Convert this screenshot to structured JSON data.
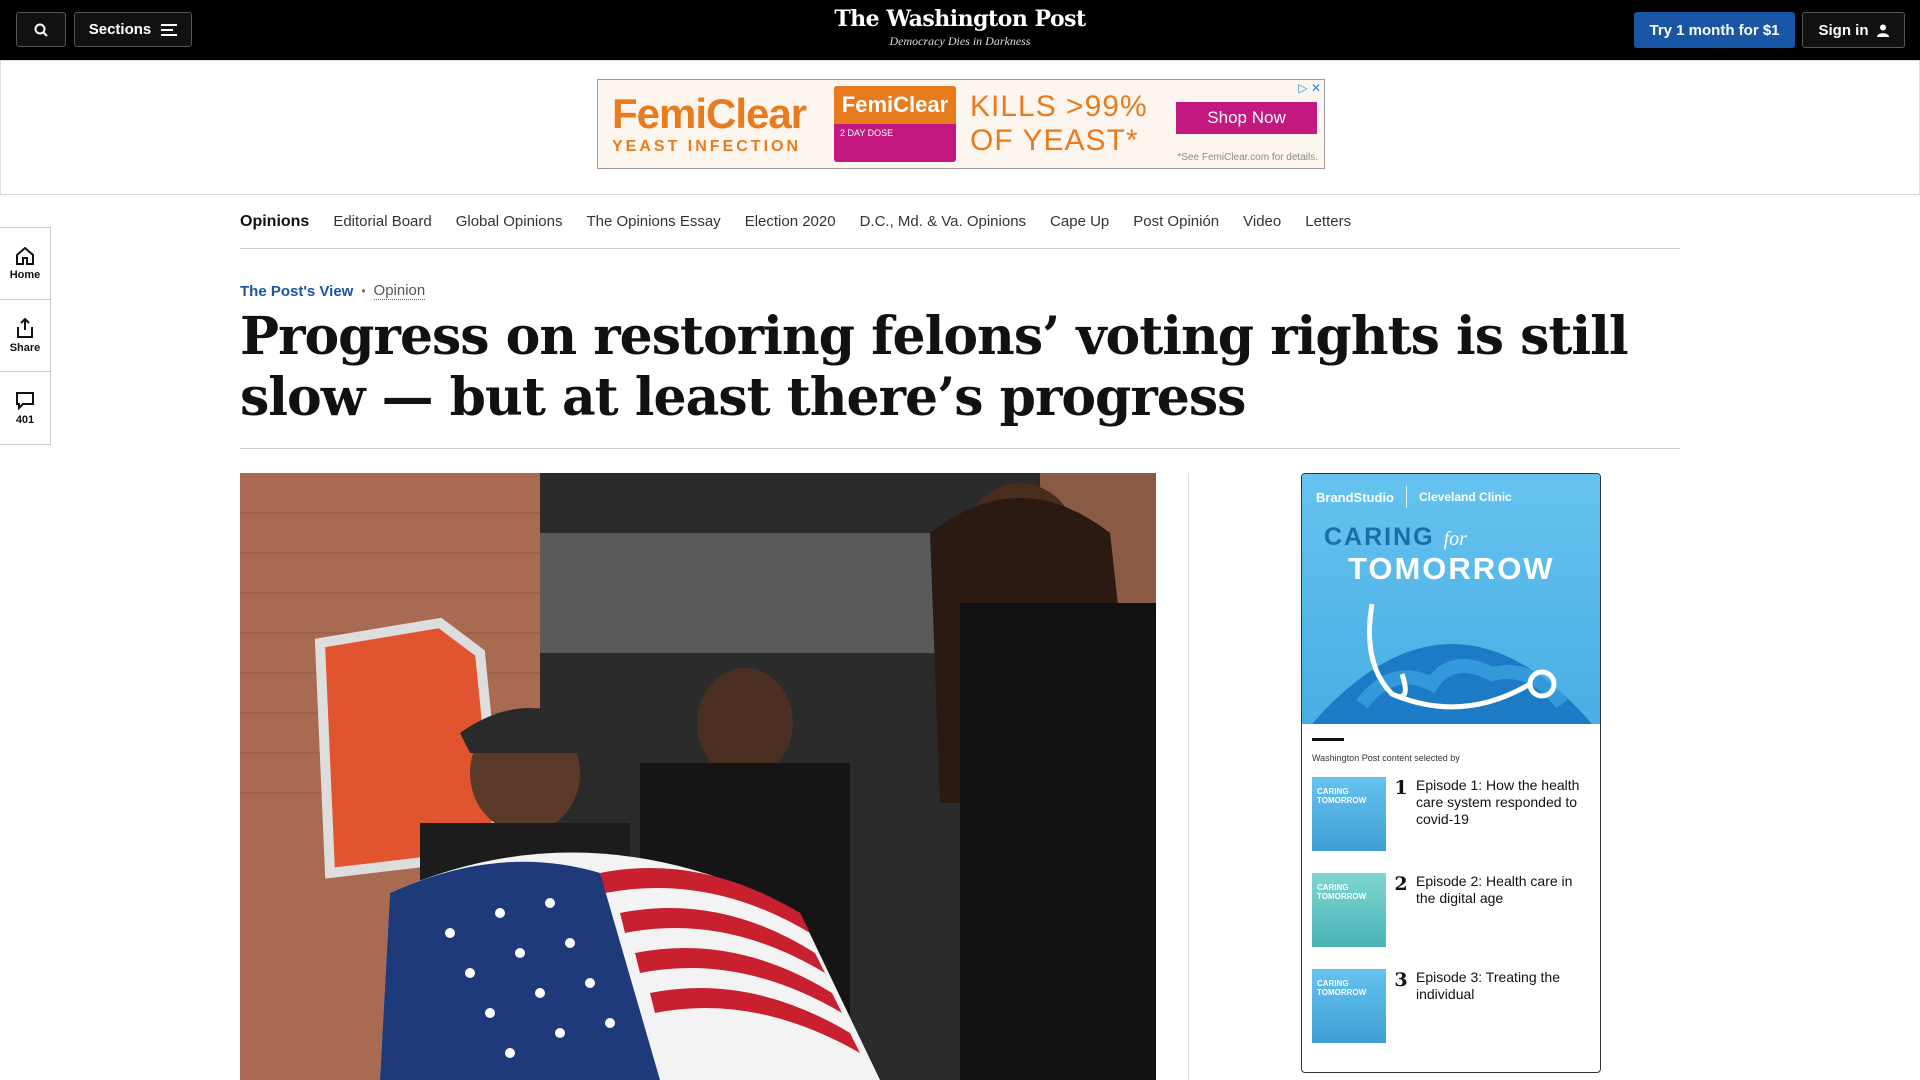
{
  "topbar": {
    "sections_label": "Sections",
    "logo_title": "The Washington Post",
    "logo_tagline": "Democracy Dies in Darkness",
    "try_label": "Try 1 month for $1",
    "signin_label": "Sign in"
  },
  "ad": {
    "brand": "FemiClear",
    "brand_sub": "YEAST INFECTION",
    "box_label": "FemiClear",
    "box_sub": "2 DAY DOSE",
    "claim_line1": "KILLS >99%",
    "claim_line2": "OF YEAST*",
    "shop_label": "Shop Now",
    "fine_print": "*See FemiClear.com for details."
  },
  "subnav": {
    "items": [
      "Opinions",
      "Editorial Board",
      "Global Opinions",
      "The Opinions Essay",
      "Election 2020",
      "D.C., Md. & Va. Opinions",
      "Cape Up",
      "Post Opinión",
      "Video",
      "Letters"
    ]
  },
  "rail": {
    "home_label": "Home",
    "share_label": "Share",
    "comments_count": "401"
  },
  "article": {
    "kicker": "The Post's View",
    "section": "Opinion",
    "headline": "Progress on restoring felons’ voting rights is still slow — but at least there’s progress"
  },
  "sponsored": {
    "studio": "BrandStudio",
    "sponsor": "Cleveland Clinic",
    "series_line1": "CARING",
    "series_for": "for",
    "series_line2": "TOMORROW",
    "selected_by": "Washington Post content selected by",
    "episodes": [
      {
        "num": "1",
        "title": "Episode 1: How the health care system responded to covid-19"
      },
      {
        "num": "2",
        "title": "Episode 2: Health care in the digital age"
      },
      {
        "num": "3",
        "title": "Episode 3: Treating the individual"
      }
    ]
  }
}
